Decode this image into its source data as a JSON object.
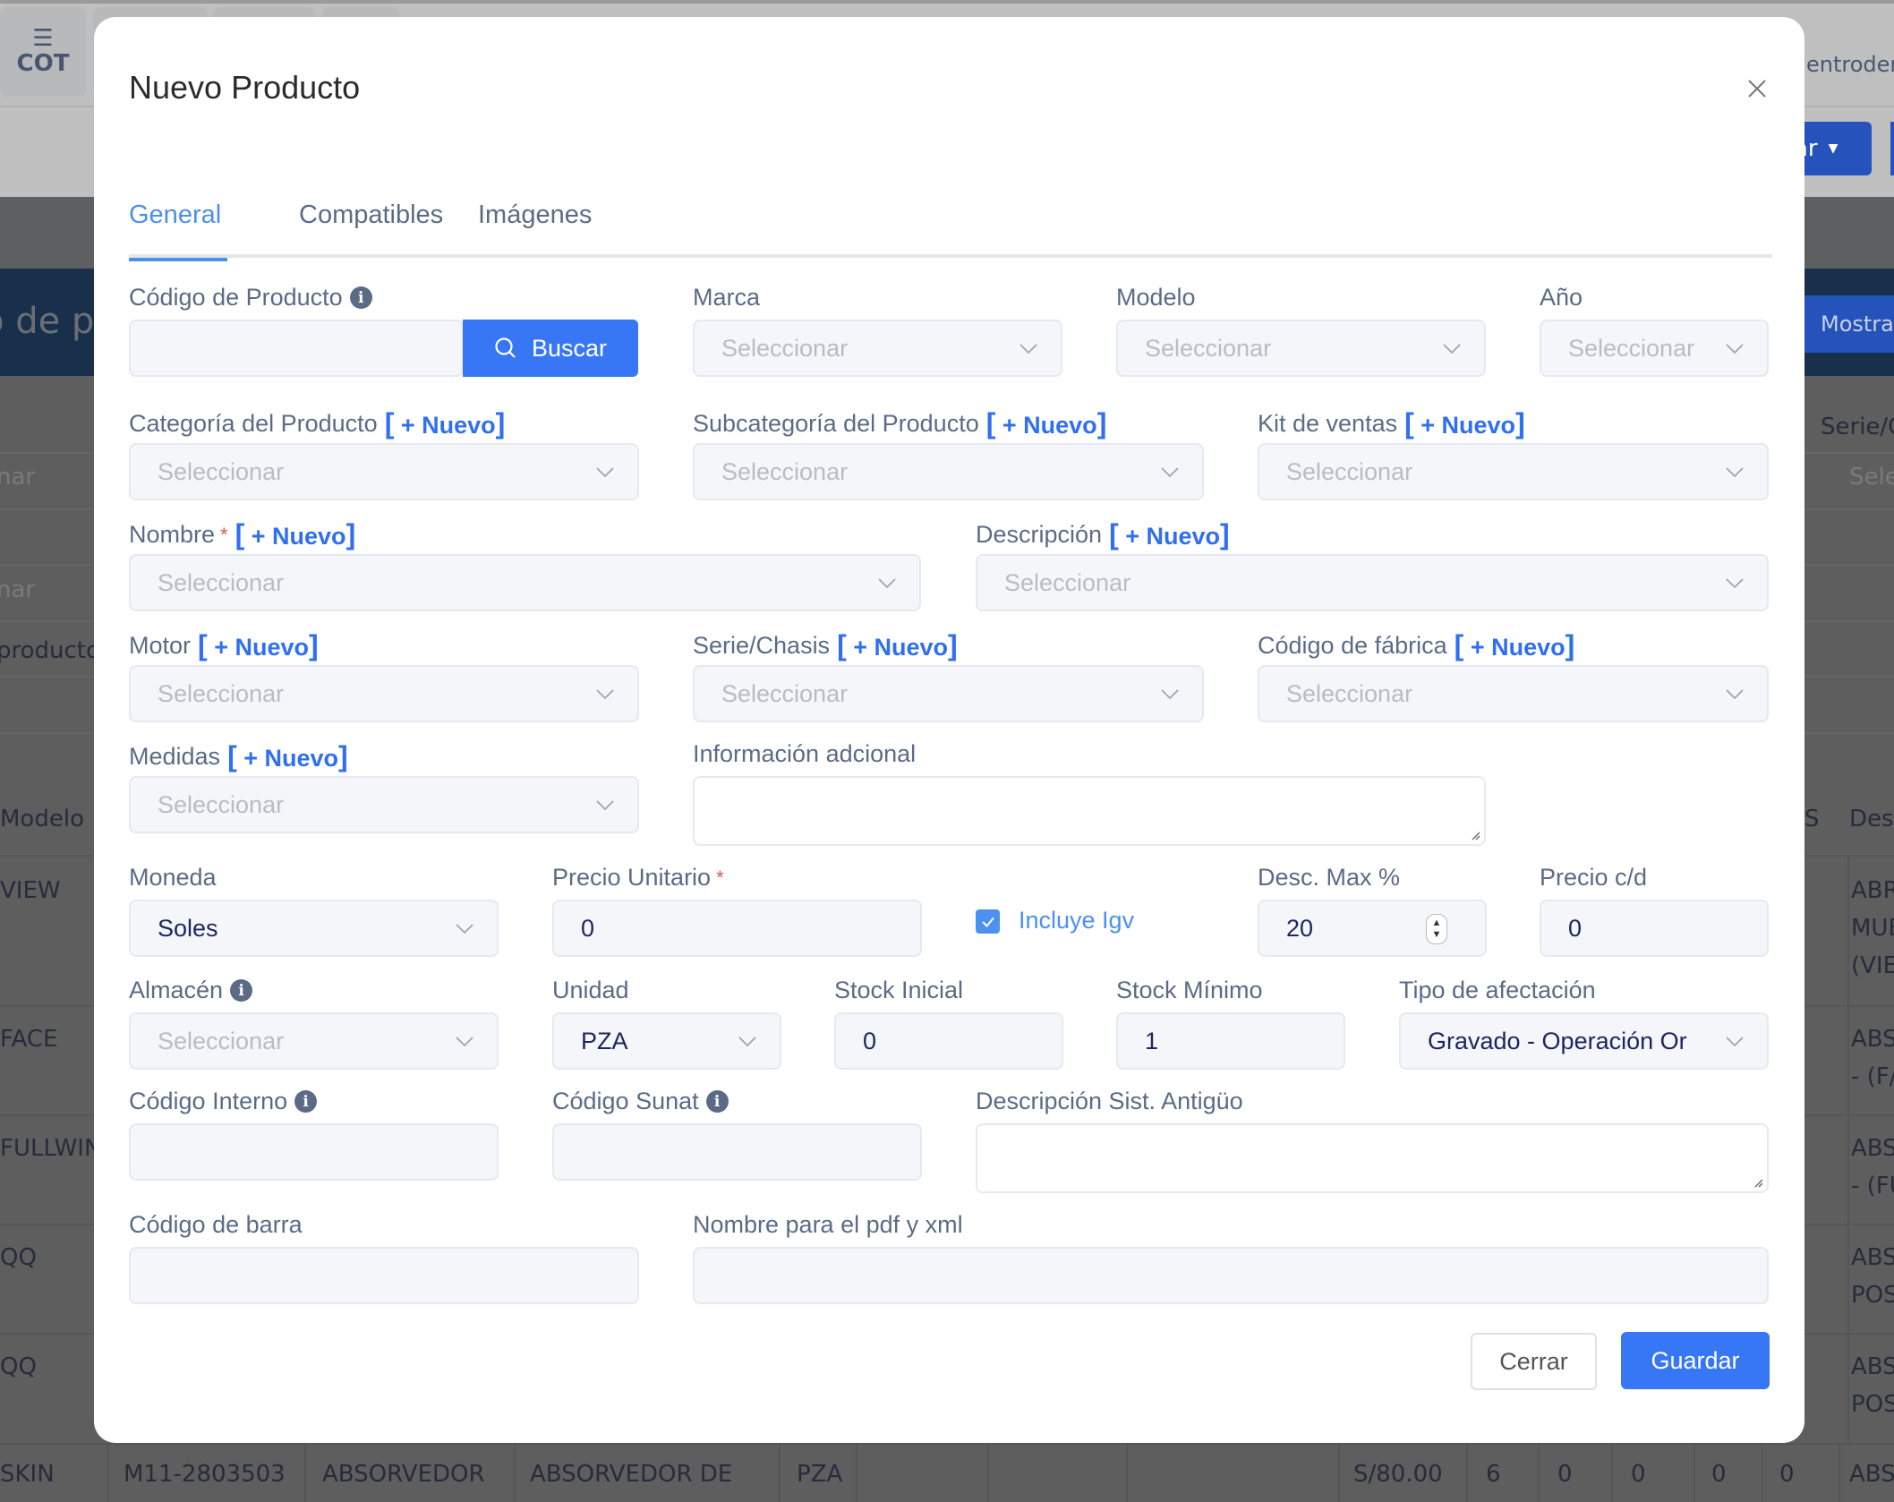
{
  "background": {
    "nav_badge": "COT",
    "user_text": "entrodere",
    "export_button": "ar",
    "banner_title": "o de p",
    "show_button": "Mostra",
    "filter_placeholder_1": "nar",
    "filter_placeholder_2": "nar",
    "filter_text_3": "producto",
    "right_filter_label": "Serie/C",
    "right_filter_placeholder": "Sele",
    "table": {
      "header_left": "Modelo",
      "header_right_1": "S",
      "header_right_2": "Des.",
      "rows": [
        {
          "modelo": "VIEW",
          "desc": [
            "ABR",
            "MUE",
            "(VIE"
          ]
        },
        {
          "modelo": "FACE",
          "desc": [
            "ABS",
            "- (F/"
          ]
        },
        {
          "modelo": "FULLWIN",
          "desc": [
            "ABS",
            "- (FU"
          ]
        },
        {
          "modelo": "QQ",
          "desc": [
            "ABS",
            "POS"
          ]
        },
        {
          "modelo": "QQ",
          "desc": [
            "ABS",
            "POS"
          ]
        }
      ],
      "last_row": [
        "SKIN",
        "M11-2803503",
        "ABSORVEDOR",
        "ABSORVEDOR DE",
        "PZA",
        "",
        "",
        "",
        "S/80.00",
        "6",
        "0",
        "0",
        "0",
        "0",
        "ABS"
      ]
    }
  },
  "modal": {
    "title": "Nuevo Producto",
    "tabs": [
      {
        "label": "General",
        "active": true
      },
      {
        "label": "Compatibles",
        "active": false
      },
      {
        "label": "Imágenes",
        "active": false
      }
    ],
    "nuevo_link": "+ Nuevo",
    "required_mark": "*",
    "placeholder_select": "Seleccionar",
    "fields": {
      "codigo_producto": {
        "label": "Código de Producto",
        "value": "",
        "search_button": "Buscar"
      },
      "marca": {
        "label": "Marca",
        "value": "Seleccionar"
      },
      "modelo": {
        "label": "Modelo",
        "value": "Seleccionar"
      },
      "anio": {
        "label": "Año",
        "value": "Seleccionar"
      },
      "categoria": {
        "label": "Categoría del Producto",
        "value": "Seleccionar"
      },
      "subcategoria": {
        "label": "Subcategoría del Producto",
        "value": "Seleccionar"
      },
      "kit_ventas": {
        "label": "Kit de ventas",
        "value": "Seleccionar"
      },
      "nombre": {
        "label": "Nombre",
        "value": "Seleccionar"
      },
      "descripcion": {
        "label": "Descripción",
        "value": "Seleccionar"
      },
      "motor": {
        "label": "Motor",
        "value": "Seleccionar"
      },
      "serie_chasis": {
        "label": "Serie/Chasis",
        "value": "Seleccionar"
      },
      "codigo_fabrica": {
        "label": "Código de fábrica",
        "value": "Seleccionar"
      },
      "medidas": {
        "label": "Medidas",
        "value": "Seleccionar"
      },
      "info_adicional": {
        "label": "Información adcional",
        "value": ""
      },
      "moneda": {
        "label": "Moneda",
        "value": "Soles"
      },
      "precio_unitario": {
        "label": "Precio Unitario",
        "value": "0"
      },
      "incluye_igv": {
        "label": "Incluye Igv",
        "checked": true
      },
      "desc_max": {
        "label": "Desc. Max %",
        "value": "20"
      },
      "precio_cd": {
        "label": "Precio c/d",
        "value": "0"
      },
      "almacen": {
        "label": "Almacén",
        "value": "Seleccionar"
      },
      "unidad": {
        "label": "Unidad",
        "value": "PZA"
      },
      "stock_inicial": {
        "label": "Stock Inicial",
        "value": "0"
      },
      "stock_minimo": {
        "label": "Stock Mínimo",
        "value": "1"
      },
      "tipo_afectacion": {
        "label": "Tipo de afectación",
        "value": "Gravado - Operación Or"
      },
      "codigo_interno": {
        "label": "Código Interno",
        "value": ""
      },
      "codigo_sunat": {
        "label": "Código Sunat",
        "value": ""
      },
      "desc_sist_antiguo": {
        "label": "Descripción Sist. Antigüo",
        "value": ""
      },
      "codigo_barra": {
        "label": "Código de barra",
        "value": ""
      },
      "nombre_pdf_xml": {
        "label": "Nombre para el pdf y xml",
        "value": ""
      }
    },
    "buttons": {
      "close": "Cerrar",
      "save": "Guardar"
    }
  },
  "colors": {
    "primary": "#3777f5",
    "tab_active": "#4a90e8",
    "label": "#5b6b86",
    "required": "#e0554e",
    "overlay": "#5e5e5e"
  }
}
